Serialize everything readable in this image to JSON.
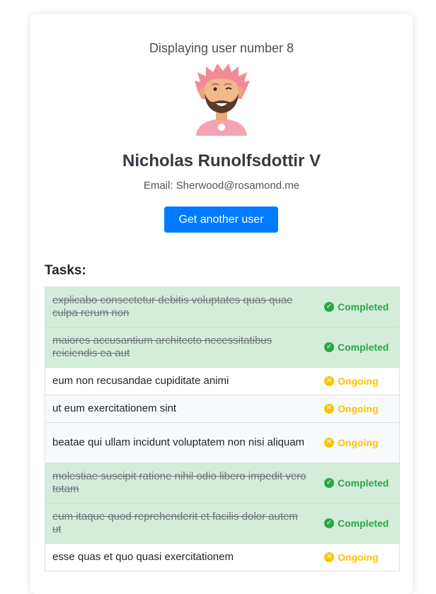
{
  "header": {
    "subtitle": "Displaying user number 8"
  },
  "user": {
    "name": "Nicholas Runolfsdottir V",
    "email_label": "Email: Sherwood@rosamond.me"
  },
  "actions": {
    "get_user_label": "Get another user"
  },
  "tasks": {
    "heading": "Tasks:",
    "items": [
      {
        "text": "explicabo consectetur debitis voluptates quas quae culpa rerum non",
        "status": "Completed",
        "icon": "check-circle-icon"
      },
      {
        "text": "maiores accusantium architecto necessitatibus reiciendis ea aut",
        "status": "Completed",
        "icon": "check-circle-icon"
      },
      {
        "text": "eum non recusandae cupiditate animi",
        "status": "Ongoing",
        "icon": "times-circle-icon"
      },
      {
        "text": "ut eum exercitationem sint",
        "status": "Ongoing",
        "icon": "times-circle-icon"
      },
      {
        "text": "beatae qui ullam incidunt voluptatem non nisi aliquam",
        "status": "Ongoing",
        "icon": "times-circle-icon"
      },
      {
        "text": "molestiae suscipit ratione nihil odio libero impedit vero totam",
        "status": "Completed",
        "icon": "check-circle-icon"
      },
      {
        "text": "eum itaque quod reprehenderit et facilis dolor autem ut",
        "status": "Completed",
        "icon": "check-circle-icon"
      },
      {
        "text": "esse quas et quo quasi exercitationem",
        "status": "Ongoing",
        "icon": "times-circle-icon"
      }
    ]
  },
  "colors": {
    "primary": "#007bff",
    "completed": "#28a745",
    "ongoing": "#ffc107",
    "completed_row_bg": "#d4edda"
  }
}
